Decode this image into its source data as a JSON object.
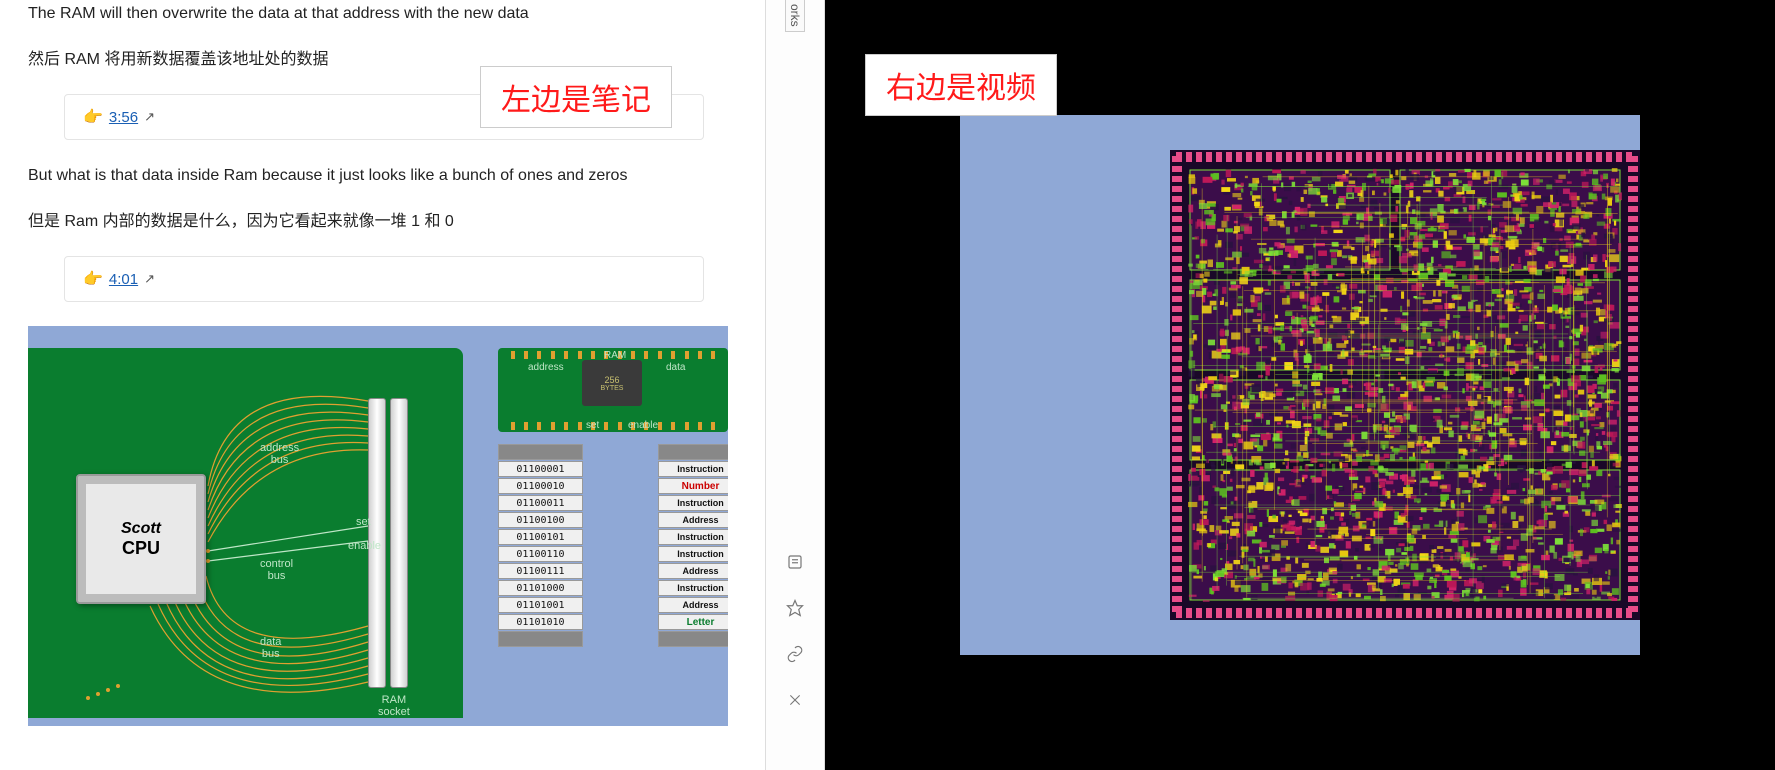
{
  "notes": {
    "line1_en": "The RAM will then overwrite the data at that address with the new data",
    "line1_zh": "然后 RAM 将用新数据覆盖该地址处的数据",
    "ts1": "3:56",
    "line2_en": "But what is that data inside Ram because it just looks like a bunch of ones and zeros",
    "line2_zh": "但是 Ram 内部的数据是什么，因为它看起来就像一堆 1 和 0",
    "ts2": "4:01"
  },
  "overlay": {
    "left": "左边是笔记",
    "right": "右边是视频"
  },
  "sidebar": {
    "tab": "orks"
  },
  "diagram": {
    "cpu_name": "Scott",
    "cpu_sub": "CPU",
    "address_bus": "address\nbus",
    "control_bus": "control\nbus",
    "data_bus": "data\nbus",
    "set": "set",
    "enable": "enable",
    "ram_socket": "RAM\nsocket",
    "ram_title": "RAM",
    "ram_bytes": "256",
    "ram_bytes_lbl": "BYTES",
    "ram_addr_lbl": "address",
    "ram_data_lbl": "data",
    "ram_set": "set",
    "ram_enable": "enable",
    "addr_col": [
      "01100001",
      "01100010",
      "01100011",
      "01100100",
      "01100101",
      "01100110",
      "01100111",
      "01101000",
      "01101001",
      "01101010"
    ],
    "data_col": [
      {
        "t": "Instruction",
        "c": "plain"
      },
      {
        "t": "Number",
        "c": "red"
      },
      {
        "t": "Instruction",
        "c": "plain"
      },
      {
        "t": "Address",
        "c": "plain"
      },
      {
        "t": "Instruction",
        "c": "plain"
      },
      {
        "t": "Instruction",
        "c": "plain"
      },
      {
        "t": "Address",
        "c": "plain"
      },
      {
        "t": "Instruction",
        "c": "plain"
      },
      {
        "t": "Address",
        "c": "plain"
      },
      {
        "t": "Letter",
        "c": "green"
      }
    ]
  }
}
